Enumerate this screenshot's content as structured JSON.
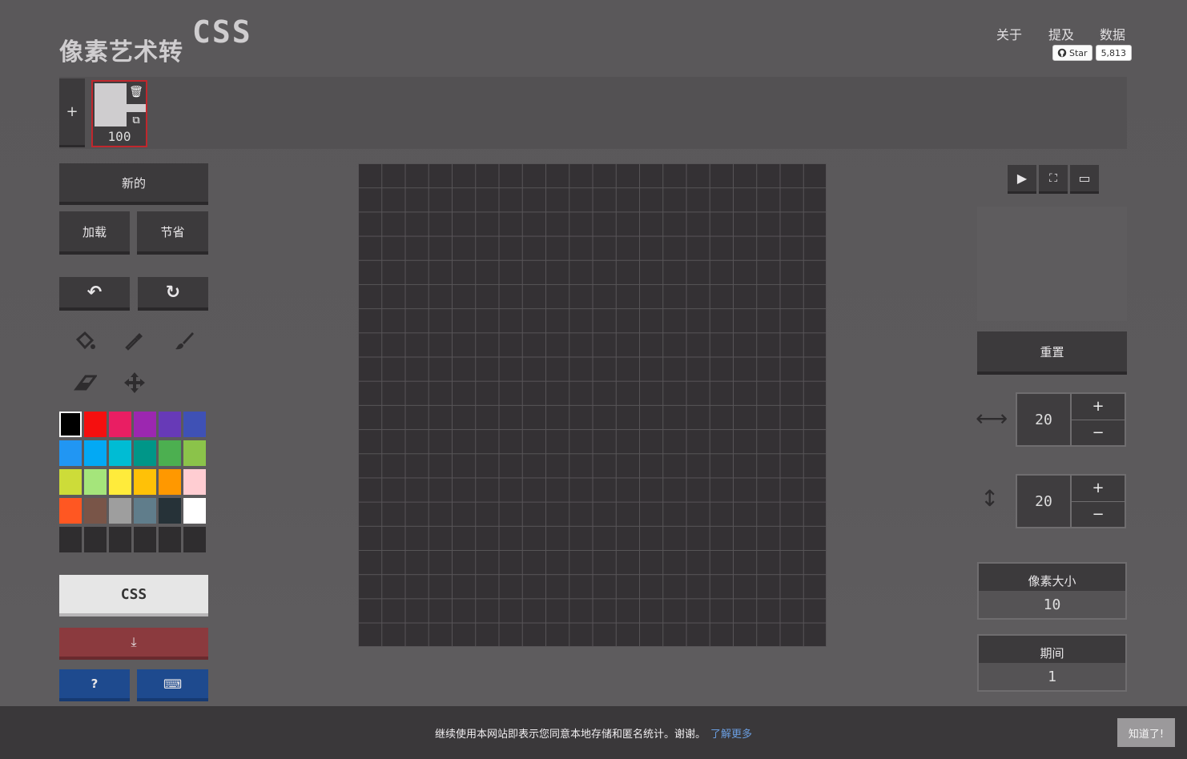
{
  "header": {
    "logo_text": "像素艺术转",
    "logo_css": "CSS",
    "nav": [
      {
        "label": "关于"
      },
      {
        "label": "提及"
      },
      {
        "label": "数据"
      }
    ],
    "github": {
      "star_label": "Star",
      "count": "5,813"
    }
  },
  "frames": {
    "add_label": "+",
    "items": [
      {
        "label": "100"
      }
    ],
    "delete_icon": "🗑",
    "duplicate_icon": "⧉"
  },
  "left_panel": {
    "new_label": "新的",
    "load_label": "加载",
    "save_label": "节省",
    "undo_icon": "↶",
    "redo_icon": "↻",
    "css_label": "CSS",
    "download_icon": "⤓",
    "help_label": "?",
    "keyboard_icon": "⌨"
  },
  "tools": {
    "bucket_icon": "bucket-icon",
    "eyedropper_icon": "eyedropper-icon",
    "brush_icon": "brush-icon",
    "eraser_icon": "eraser-icon",
    "move_icon": "move-icon"
  },
  "palette": {
    "colors": [
      "#000000",
      "#f50f0f",
      "#e91e63",
      "#9c27b0",
      "#673ab7",
      "#3f51b5",
      "#2196f3",
      "#03a9f4",
      "#00bcd4",
      "#009688",
      "#4caf50",
      "#8bc34a",
      "#cddc39",
      "#a5e57b",
      "#ffeb3b",
      "#ffc107",
      "#ff9800",
      "#ffcdd2",
      "#ff5722",
      "#795548",
      "#9e9e9e",
      "#607d8b",
      "#263238",
      "#ffffff",
      "#2f2d2f",
      "#2f2d2f",
      "#2f2d2f",
      "#2f2d2f",
      "#2f2d2f",
      "#2f2d2f"
    ],
    "selected_index": 0
  },
  "canvas": {
    "columns": 20,
    "rows": 20,
    "background": "#343134",
    "grid_color": "#575457"
  },
  "right_panel": {
    "play_icon": "▶",
    "fit_icon": "⛶",
    "fullscreen_icon": "▭",
    "reset_label": "重置",
    "width_value": "20",
    "height_value": "20",
    "plus": "+",
    "minus": "−",
    "width_icon": "⟷",
    "height_icon": "↕",
    "pixel_size_label": "像素大小",
    "pixel_size_value": "10",
    "duration_label": "期间",
    "duration_value": "1"
  },
  "cookie": {
    "message": "继续使用本网站即表示您同意本地存储和匿名统计。谢谢。",
    "link": "了解更多",
    "button": "知道了!"
  },
  "colors": {
    "accent_red": "#c0272d",
    "download_red": "#8b3a3e",
    "help_blue": "#1e4a8e",
    "css_button": "#e6e6e6"
  }
}
